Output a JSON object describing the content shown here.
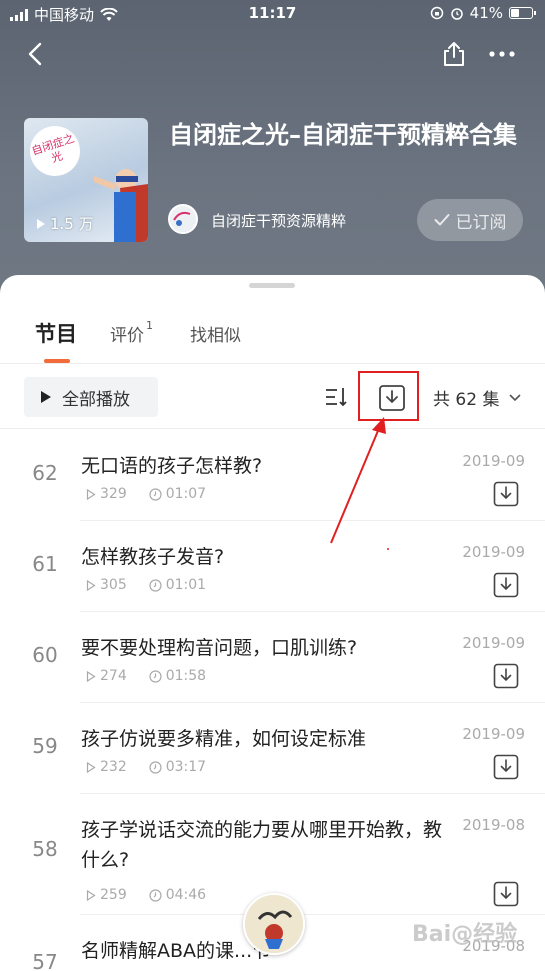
{
  "status_bar": {
    "carrier": "中国移动",
    "time": "11:17",
    "battery": "41%",
    "battery_level": 0.41
  },
  "album": {
    "title": "自闭症之光–自闭症干预精粹合集",
    "cover_text": "自闭症之光",
    "play_count": "1.5 万",
    "author": "自闭症干预资源精粹",
    "subscribe_label": "已订阅"
  },
  "tabs": [
    {
      "label": "节目",
      "badge": ""
    },
    {
      "label": "评价",
      "badge": "1"
    },
    {
      "label": "找相似",
      "badge": ""
    }
  ],
  "toolbar": {
    "play_all_label": "全部播放",
    "episode_count_label": "共 62 集"
  },
  "episodes": [
    {
      "num": "62",
      "title": "无口语的孩子怎样教?",
      "plays": "329",
      "duration": "01:07",
      "date": "2019-09"
    },
    {
      "num": "61",
      "title": "怎样教孩子发音?",
      "plays": "305",
      "duration": "01:01",
      "date": "2019-09"
    },
    {
      "num": "60",
      "title": "要不要处理构音问题，口肌训练?",
      "plays": "274",
      "duration": "01:58",
      "date": "2019-09"
    },
    {
      "num": "59",
      "title": "孩子仿说要多精准，如何设定标准",
      "plays": "232",
      "duration": "03:17",
      "date": "2019-09"
    },
    {
      "num": "58",
      "title": "孩子学说话交流的能力要从哪里开始教，教什么?",
      "plays": "259",
      "duration": "04:46",
      "date": "2019-08"
    },
    {
      "num": "57",
      "title": "名师精解ABA的课...节",
      "plays": "",
      "duration": "",
      "date": "2019-08"
    }
  ],
  "watermark": "Bai@经验",
  "colors": {
    "accent": "#f26b3a",
    "highlight": "#e02020"
  },
  "icons": [
    "back-icon",
    "share-icon",
    "more-icon",
    "play-icon",
    "check-icon",
    "sort-icon",
    "download-icon",
    "chevron-down-icon",
    "clock-icon"
  ]
}
